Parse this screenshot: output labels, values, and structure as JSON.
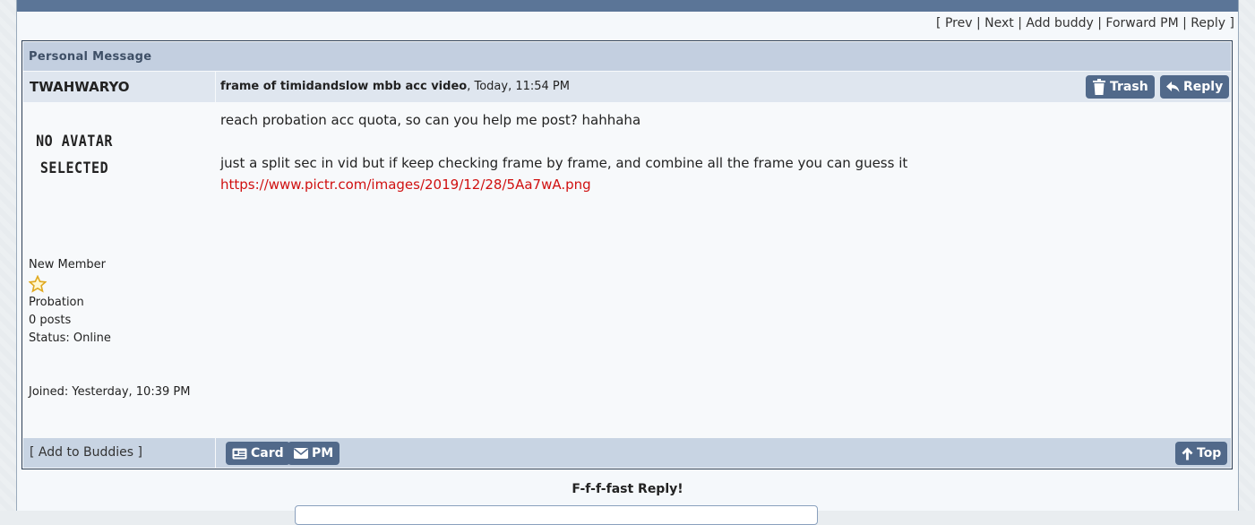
{
  "nav": {
    "open": "[",
    "prev": "Prev",
    "next": "Next",
    "add_buddy": "Add buddy",
    "forward_pm": "Forward PM",
    "reply": "Reply",
    "close": "]",
    "sep": "|"
  },
  "panel": {
    "header": "Personal Message"
  },
  "message": {
    "author": "TWAHWARYO",
    "subject": "frame of timidandslow mbb acc video",
    "date": ", Today, 11:54 PM",
    "body_line1": "reach probation acc quota, so can you help me post? hahhaha",
    "body_line2": "just a split sec in vid but if keep checking frame by frame, and combine all the frame you can guess it",
    "link": "https://www.pictr.com/images/2019/12/28/5Aa7wA.png"
  },
  "buttons": {
    "trash": "Trash",
    "reply": "Reply",
    "card": "Card",
    "pm": "PM",
    "top": "Top"
  },
  "profile": {
    "avatar_line1": "NO AVATAR",
    "avatar_line2": "SELECTED",
    "rank": "New Member",
    "group": "Probation",
    "posts": "0 posts",
    "status": "Status: Online",
    "joined": "Joined: Yesterday, 10:39 PM",
    "rank_icon": "star-icon"
  },
  "footer": {
    "add_to_buddies": "[ Add to Buddies ]"
  },
  "fast_reply": {
    "title": "F-f-f-fast Reply!"
  },
  "colors": {
    "button_bg": "#51698a",
    "header_bg": "#c3cfe0",
    "link": "#d01010",
    "topbar": "#5b7597"
  }
}
